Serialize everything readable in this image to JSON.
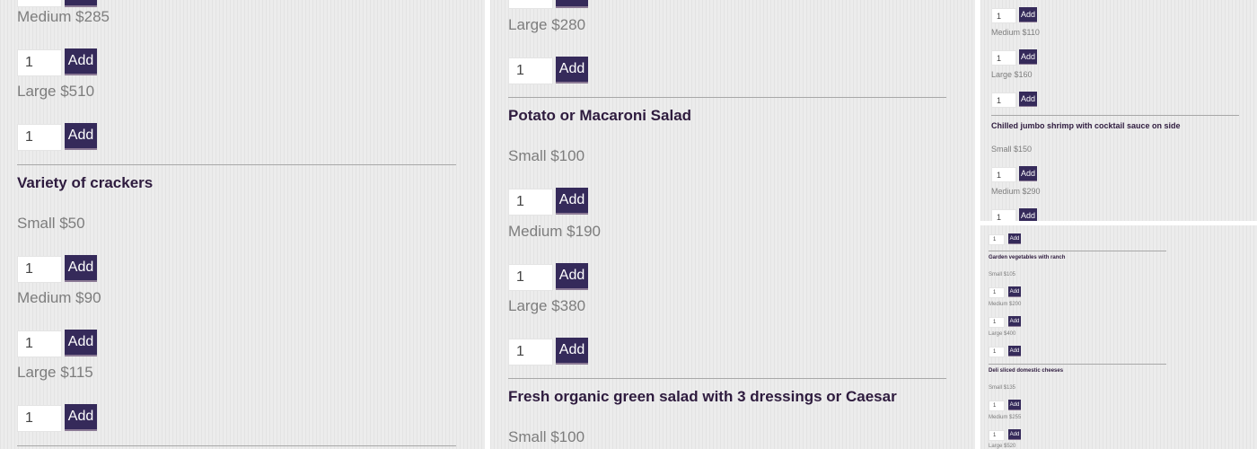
{
  "ui": {
    "add_label": "Add",
    "qty_default": "1"
  },
  "panel1": {
    "p_medium_top": "Medium $285",
    "p_large_top": "Large $510",
    "section_title": "Variety of crackers",
    "p_small": "Small $50",
    "p_medium": "Medium $90",
    "p_large": "Large $115"
  },
  "panel2": {
    "p_large_top": "Large $280",
    "potato_title": "Potato or Macaroni Salad",
    "potato_small": "Small $100",
    "potato_medium": "Medium $190",
    "potato_large": "Large $380",
    "salad_title": "Fresh organic green salad with 3 dressings or Caesar",
    "salad_small": "Small $100"
  },
  "panel3": {
    "p_medium": "Medium $110",
    "p_large": "Large $160",
    "shrimp_title": "Chilled jumbo shrimp with cocktail sauce on side",
    "shrimp_small": "Small $150",
    "shrimp_medium": "Medium $290"
  },
  "panel4": {
    "veg_title": "Garden vegetables with ranch",
    "veg_small": "Small $105",
    "veg_medium": "Medium $200",
    "veg_large": "Large $400",
    "deli_title": "Deli sliced domestic cheeses",
    "deli_small": "Small $135",
    "deli_medium": "Medium $255",
    "deli_large": "Large $520"
  }
}
